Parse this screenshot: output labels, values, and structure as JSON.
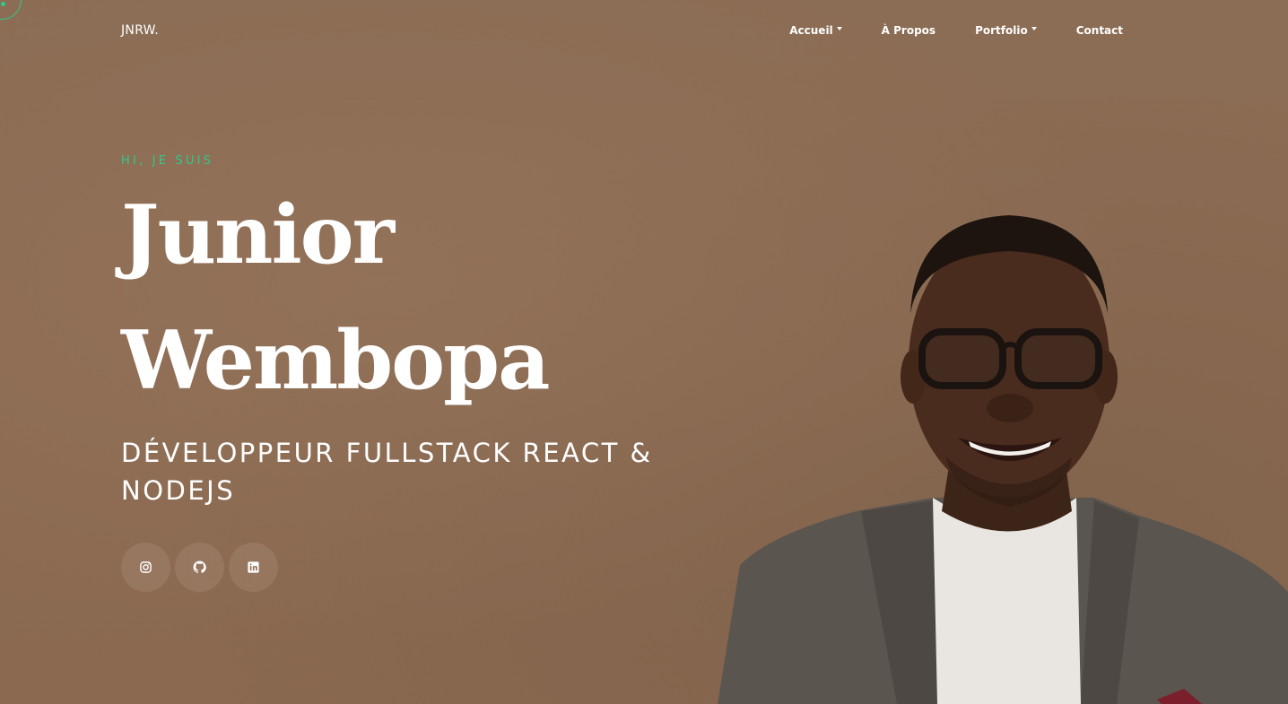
{
  "brand": "JNRW.",
  "nav": {
    "items": [
      {
        "label": "Accueil",
        "dropdown": true
      },
      {
        "label": "À Propos",
        "dropdown": false
      },
      {
        "label": "Portfolio",
        "dropdown": true
      },
      {
        "label": "Contact",
        "dropdown": false
      }
    ]
  },
  "hero": {
    "greeting": "HI, JE SUIS",
    "first_name": "Junior",
    "last_name": "Wembopa",
    "role": "DÉVELOPPEUR FULLSTACK REACT & NODEJS"
  },
  "socials": [
    {
      "icon": "instagram-icon"
    },
    {
      "icon": "github-icon"
    },
    {
      "icon": "linkedin-icon"
    }
  ],
  "colors": {
    "background": "#8a6a52",
    "accent": "#2fc98b",
    "text": "#ffffff"
  }
}
